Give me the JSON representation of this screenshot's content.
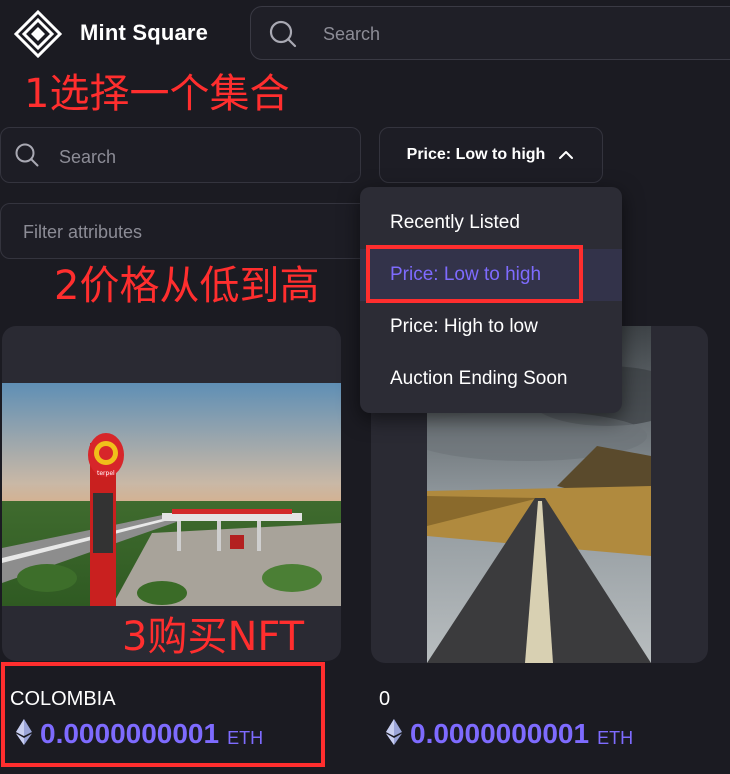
{
  "header": {
    "brand": "Mint Square",
    "search_placeholder": "Search"
  },
  "annotations": {
    "step1": "1选择一个集合",
    "step2": "2价格从低到高",
    "step3": "3购买NFT"
  },
  "collection": {
    "search_placeholder": "Search",
    "sort_label": "Price: Low to high",
    "filter_placeholder": "Filter attributes"
  },
  "sort_menu": {
    "items": [
      {
        "label": "Recently Listed"
      },
      {
        "label": "Price: Low to high",
        "active": true
      },
      {
        "label": "Price: High to low"
      },
      {
        "label": "Auction Ending Soon"
      }
    ]
  },
  "items": [
    {
      "title": "COLOMBIA",
      "price": "0.0000000001",
      "unit": "ETH",
      "image": "gas-station-photo"
    },
    {
      "title": "0",
      "price": "0.0000000001",
      "unit": "ETH",
      "image": "road-photo"
    }
  ],
  "colors": {
    "accent": "#7e6bff",
    "annotation": "#ff2e2e",
    "background": "#1b1b22"
  }
}
